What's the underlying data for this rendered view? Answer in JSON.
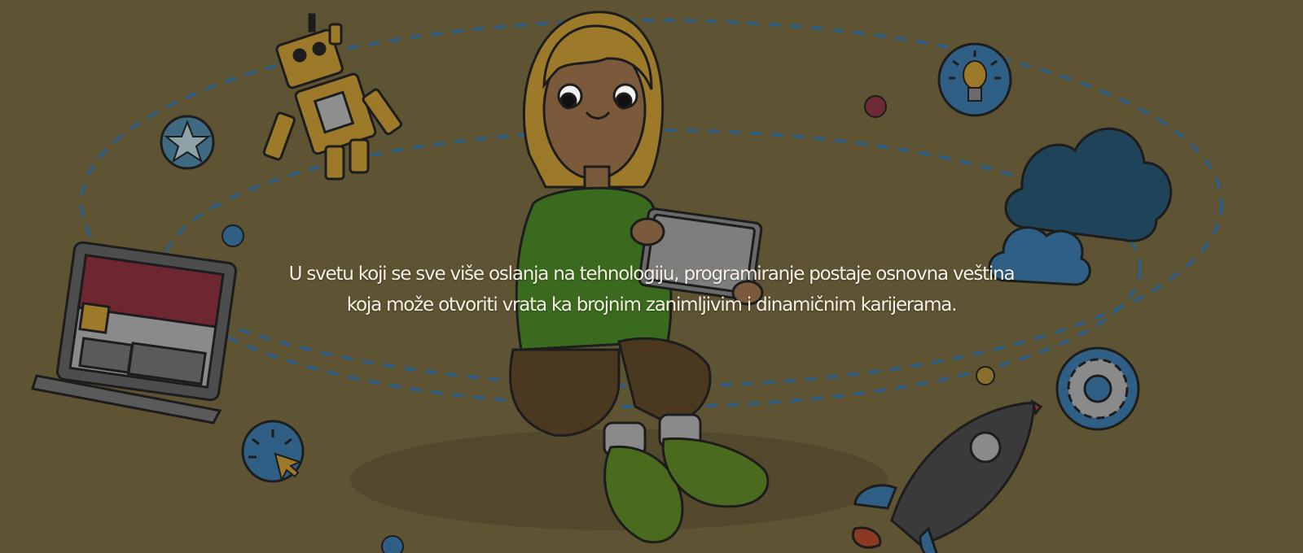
{
  "hero": {
    "caption_line1": "U svetu koji se sve više oslanja na tehnologiju, programiranje postaje osnovna veština",
    "caption_line2": "koja može otvoriti vrata ka brojnim zanimljivim i dinamičnim karijerama."
  },
  "colors": {
    "background": "#5e5333",
    "caption_text": "#f4efe2",
    "orbit_dash": "#2f5f84"
  },
  "illustration": {
    "icons": [
      "robot-icon",
      "star-icon",
      "laptop-icon",
      "pointer-click-icon",
      "lightbulb-icon",
      "cloud-icon",
      "gear-icon",
      "rocket-icon"
    ]
  }
}
